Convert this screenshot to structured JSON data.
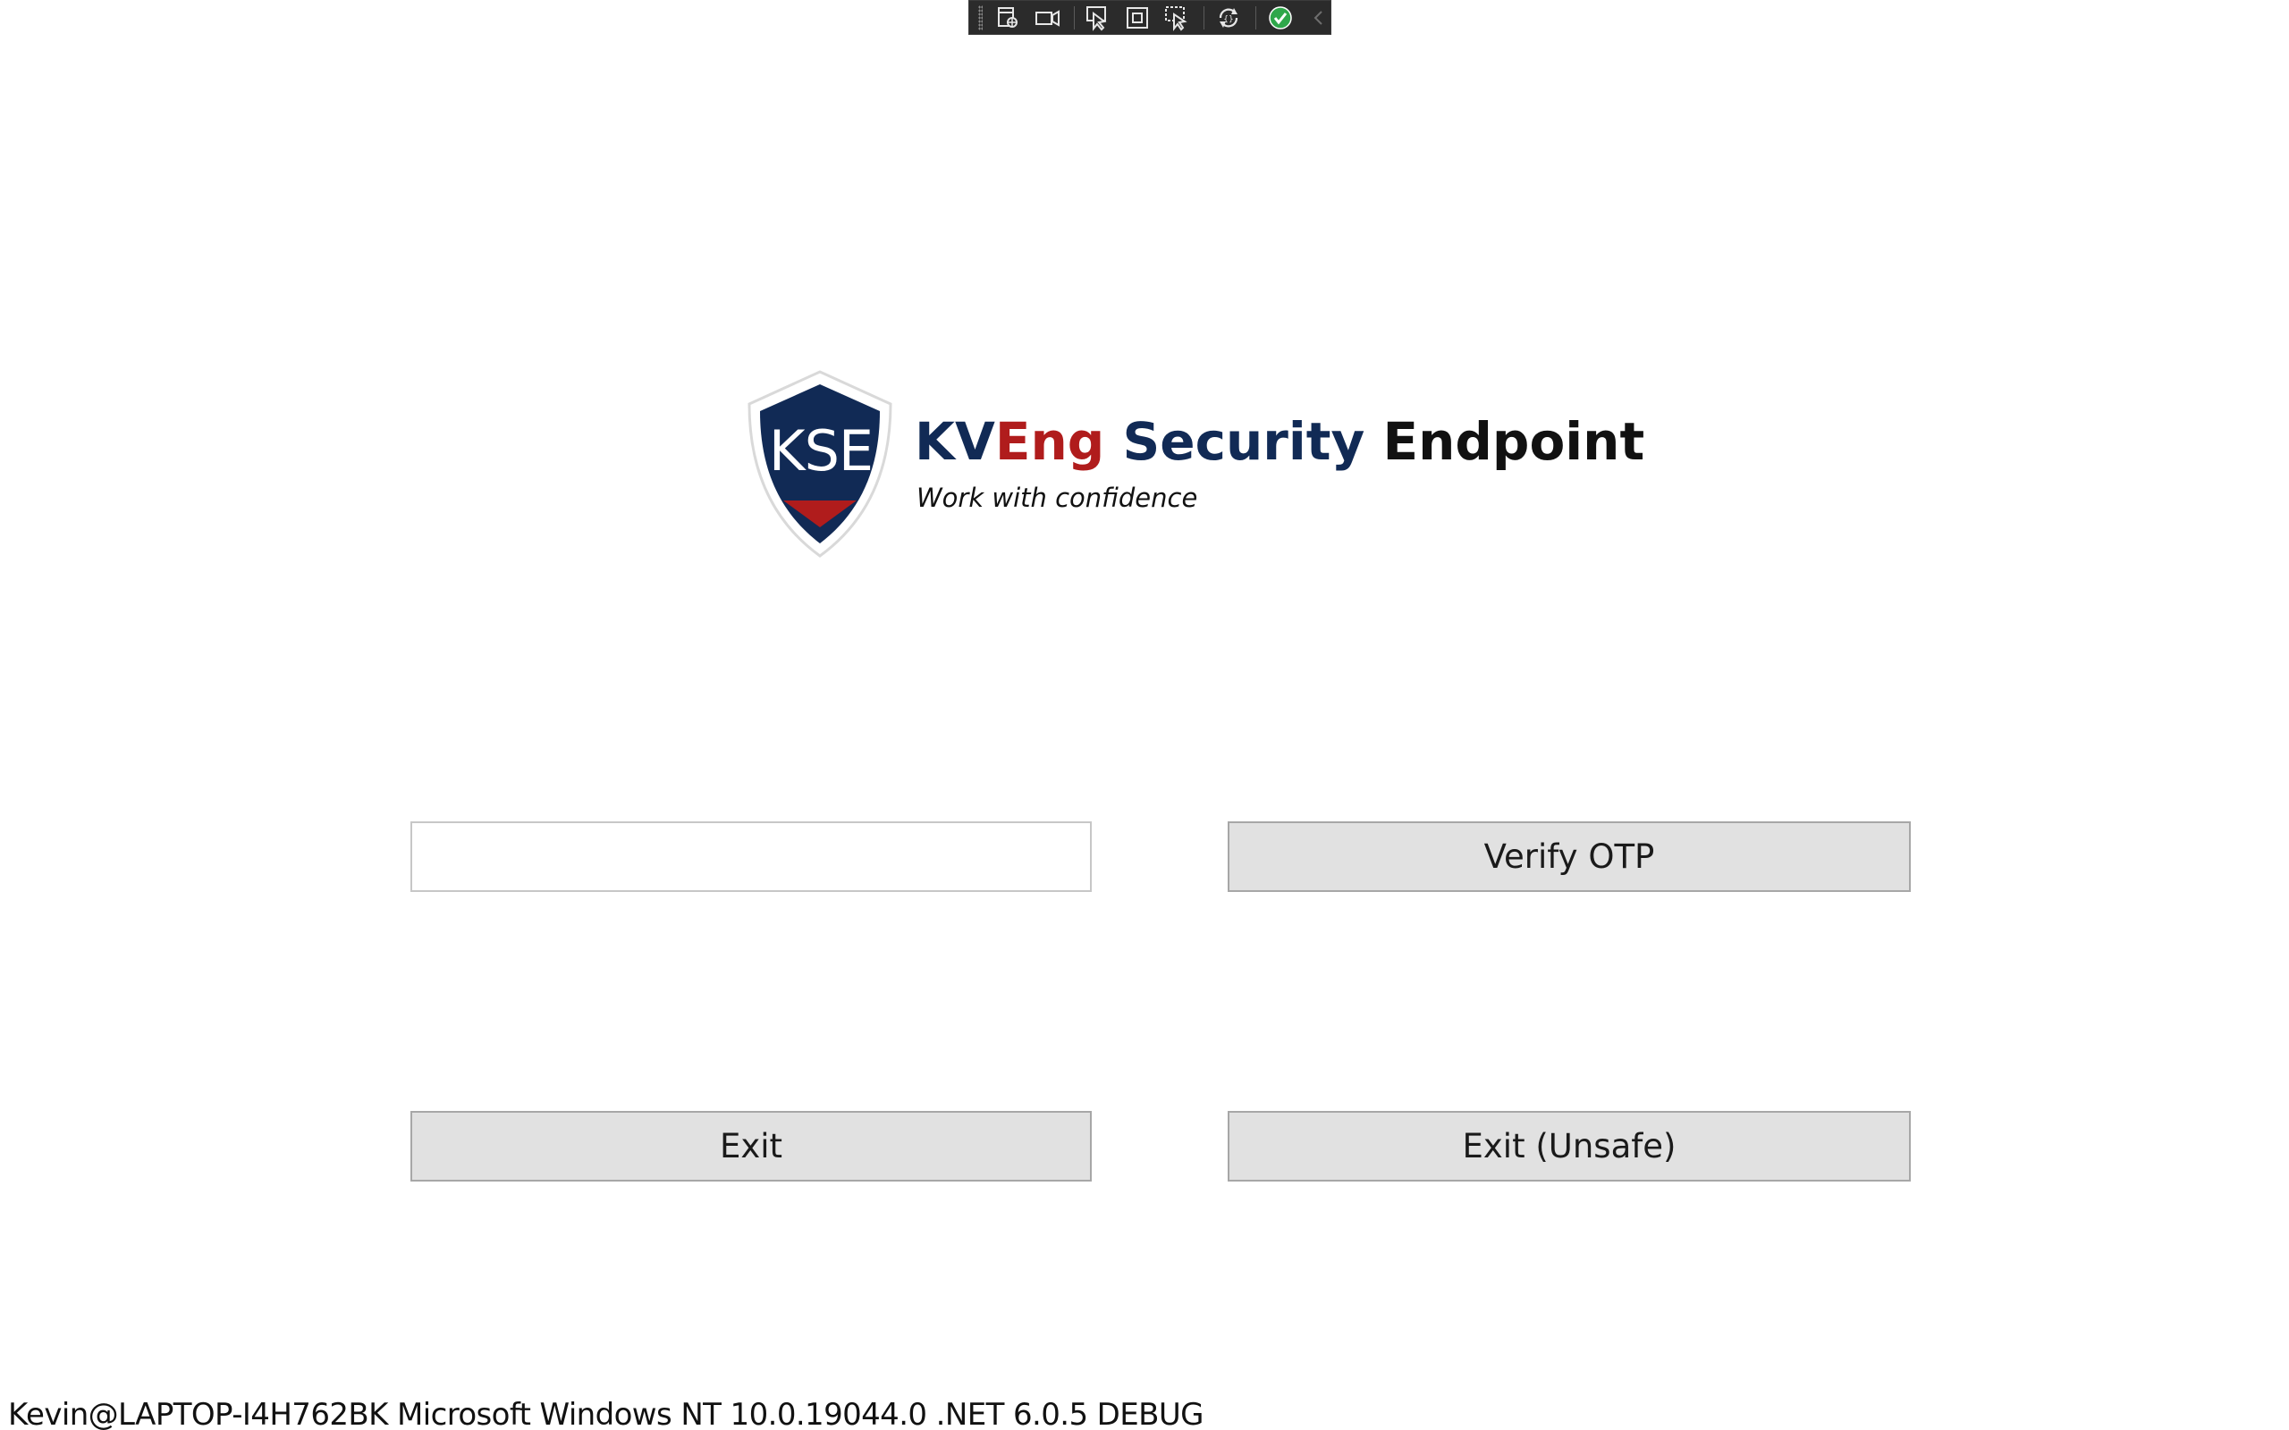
{
  "window": {
    "background": "#ffffff"
  },
  "devbar": {
    "tools": [
      "visual-tree-icon",
      "video-camera-icon",
      "select-element-icon",
      "display-layout-adorners-icon",
      "track-focus-icon",
      "hot-reload-icon",
      "binding-status-ok-icon",
      "collapse-chevron-icon"
    ]
  },
  "logo": {
    "badge_text": "KSE",
    "title_part_kv": "KV",
    "title_part_eng": "Eng",
    "title_part_security": "Security",
    "title_part_endpoint": "Endpoint",
    "tagline": "Work with confidence",
    "colors": {
      "navy": "#112a55",
      "red": "#b01c1c",
      "black": "#111111"
    }
  },
  "form": {
    "otp_value": "",
    "verify_label": "Verify OTP",
    "exit_label": "Exit",
    "exit_unsafe_label": "Exit (Unsafe)"
  },
  "status": {
    "text": "Kevin@LAPTOP-I4H762BK Microsoft Windows NT 10.0.19044.0 .NET 6.0.5 DEBUG"
  }
}
